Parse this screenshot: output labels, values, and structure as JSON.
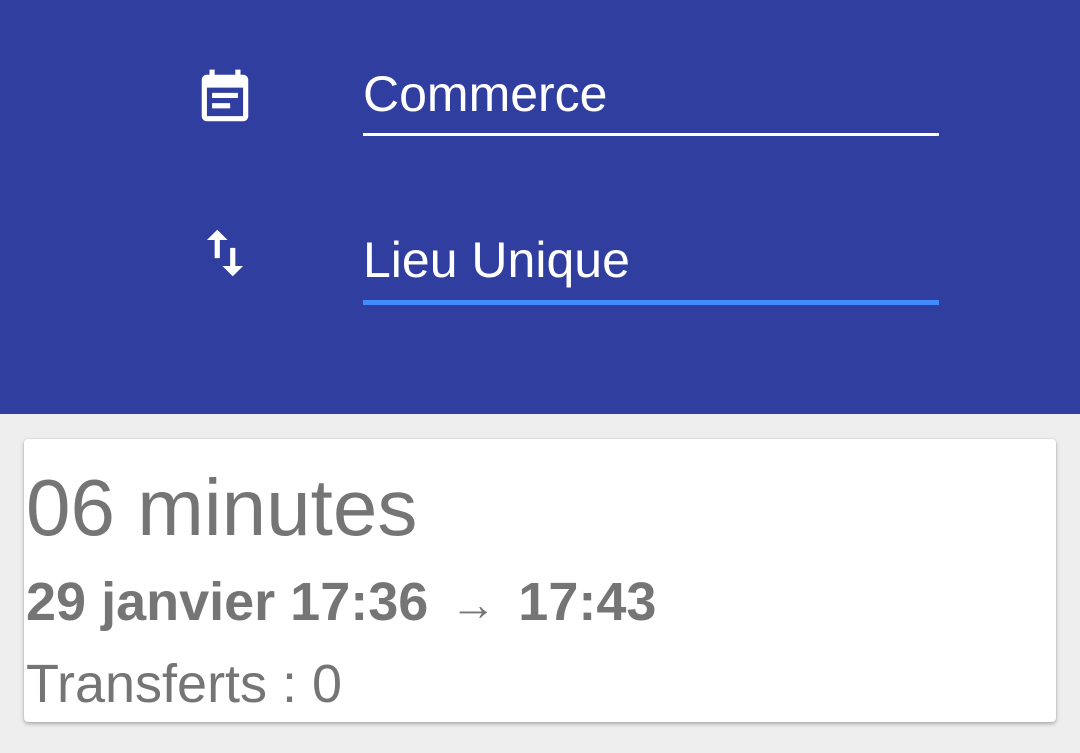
{
  "header": {
    "background_color": "#303f9f",
    "fields": [
      {
        "icon": "calendar-icon",
        "value": "Commerce",
        "underline_color": "#ffffff",
        "focused": false
      },
      {
        "icon": "swap-vertical-icon",
        "value": "Lieu Unique",
        "underline_color": "#448aff",
        "focused": true
      }
    ]
  },
  "result_card": {
    "duration": "06 minutes",
    "departure": "29 janvier 17:36",
    "arrow": "→",
    "arrival": "17:43",
    "transfers": "Transferts : 0",
    "text_color": "#757575"
  }
}
